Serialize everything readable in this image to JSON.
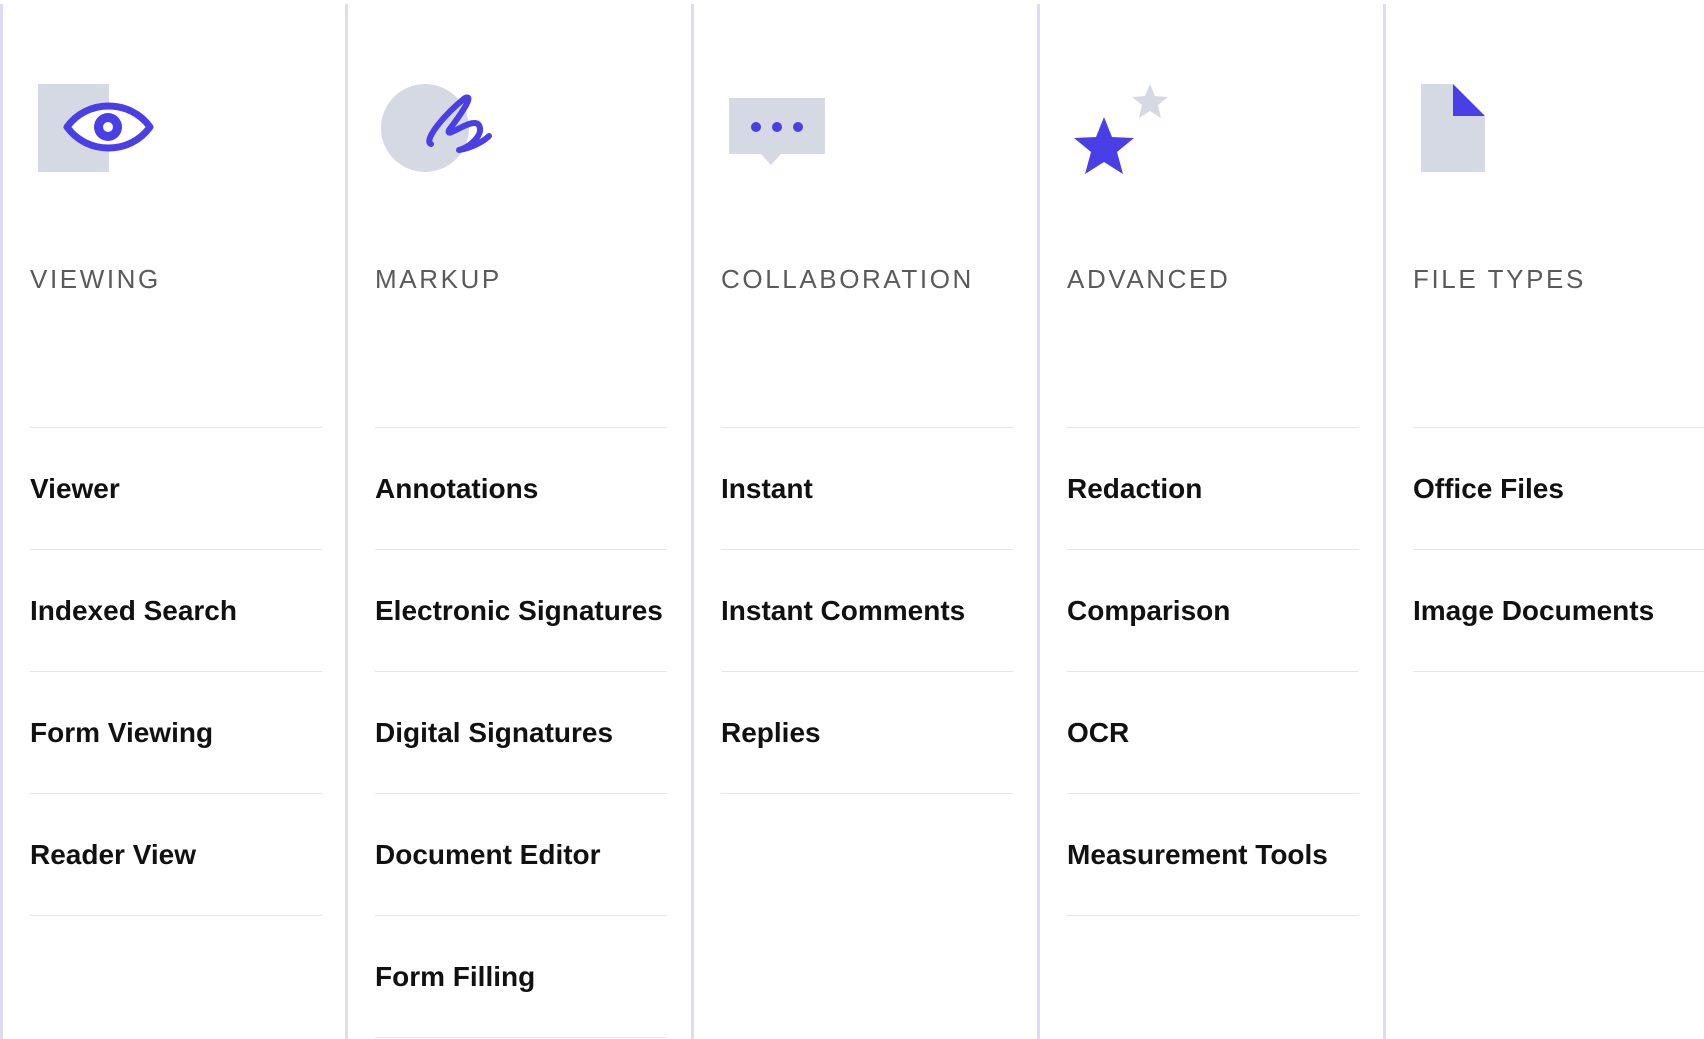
{
  "colors": {
    "accent": "#4a3ee6",
    "icon_gray": "#d5d9e3",
    "divider": "#dddcf3",
    "heading": "#5a5a5a",
    "item": "#111111"
  },
  "columns": [
    {
      "heading": "VIEWING",
      "icon": "eye-icon",
      "items": [
        "Viewer",
        "Indexed Search",
        "Form Viewing",
        "Reader View"
      ]
    },
    {
      "heading": "MARKUP",
      "icon": "signature-scribble-icon",
      "items": [
        "Annotations",
        "Electronic Signatures",
        "Digital Signatures",
        "Document Editor",
        "Form Filling"
      ]
    },
    {
      "heading": "COLLABORATION",
      "icon": "chat-bubble-icon",
      "items": [
        "Instant",
        "Instant Comments",
        "Replies"
      ]
    },
    {
      "heading": "ADVANCED",
      "icon": "stars-icon",
      "items": [
        "Redaction",
        "Comparison",
        "OCR",
        "Measurement Tools"
      ]
    },
    {
      "heading": "FILE TYPES",
      "icon": "document-icon",
      "items": [
        "Office Files",
        "Image Documents"
      ]
    }
  ]
}
